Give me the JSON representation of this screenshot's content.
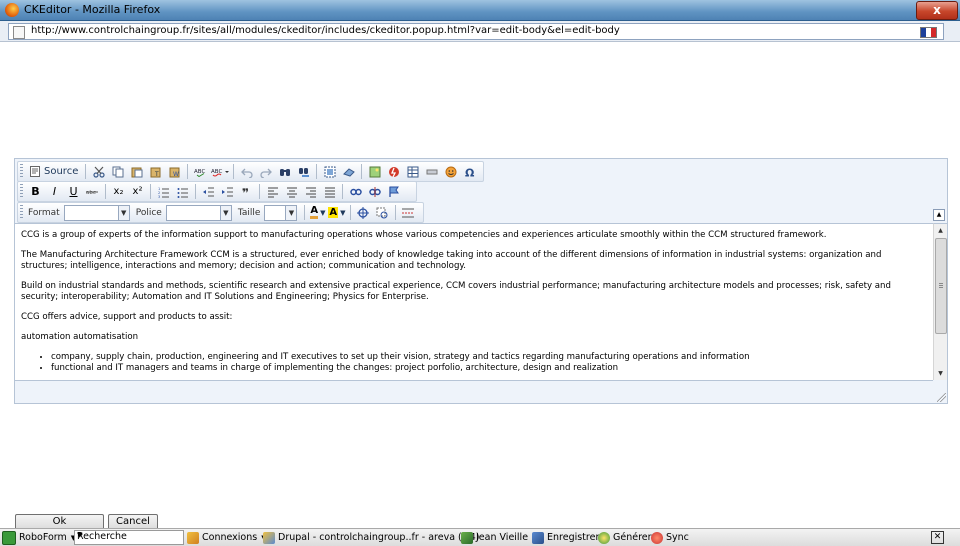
{
  "window": {
    "title": "CKEditor - Mozilla Firefox",
    "close_label": "x"
  },
  "address_bar": {
    "url": "http://www.controlchaingroup.fr/sites/all/modules/ckeditor/includes/ckeditor.popup.html?var=edit-body&el=edit-body"
  },
  "toolbar": {
    "source_label": "Source",
    "format_label": "Format",
    "font_label": "Police",
    "size_label": "Taille",
    "format_value": "",
    "font_value": "",
    "size_value": "",
    "bold_label": "B",
    "italic_label": "I",
    "underline_label": "U",
    "subscript_label": "x₂",
    "superscript_label": "x²",
    "text_color_label": "A",
    "bg_color_label": "A"
  },
  "content": {
    "paragraphs": [
      " CCG is a group of experts of the information support to manufacturing operations whose various competencies and experiences articulate smoothly within the CCM structured framework.",
      "The Manufacturing Architecture Framework CCM is a structured, ever enriched body of knowledge taking into account of the different dimensions of information in industrial systems: organization and structures; intelligence, interactions and memory; decision and action; communication and technology.",
      "Build on industrial standards and methods, scientific research and extensive practical experience, CCM covers industrial performance; manufacturing architecture models and processes; risk, safety and security; interoperability; Automation and IT Solutions and Engineering; Physics for Enterprise.",
      "CCG offers advice, support and products to assit:",
      "automation automatisation"
    ],
    "list_items": [
      "company, supply chain, production, engineering and IT executives to set up their vision, strategy and tactics regarding manufacturing operations and information",
      "functional and IT managers and teams in charge of implementing the changes: project porfolio, architecture, design and realization"
    ]
  },
  "dialog": {
    "ok_label": "Ok",
    "cancel_label": "Cancel"
  },
  "bottom_bar": {
    "roboform_label": "RoboForm",
    "search_value": "Recherche",
    "connexions_label": "Connexions",
    "drupal_label": "Drupal - controlchaingroup..fr - areva (+4)",
    "jean_label": "Jean Vieille",
    "enregistrer_label": "Enregistrer",
    "generer_label": "Générer",
    "sync_label": "Sync"
  },
  "colors": {
    "accent": "#4e82b4",
    "toolbar_bg": "#eef3fa",
    "link_blue": "#203a5c"
  }
}
